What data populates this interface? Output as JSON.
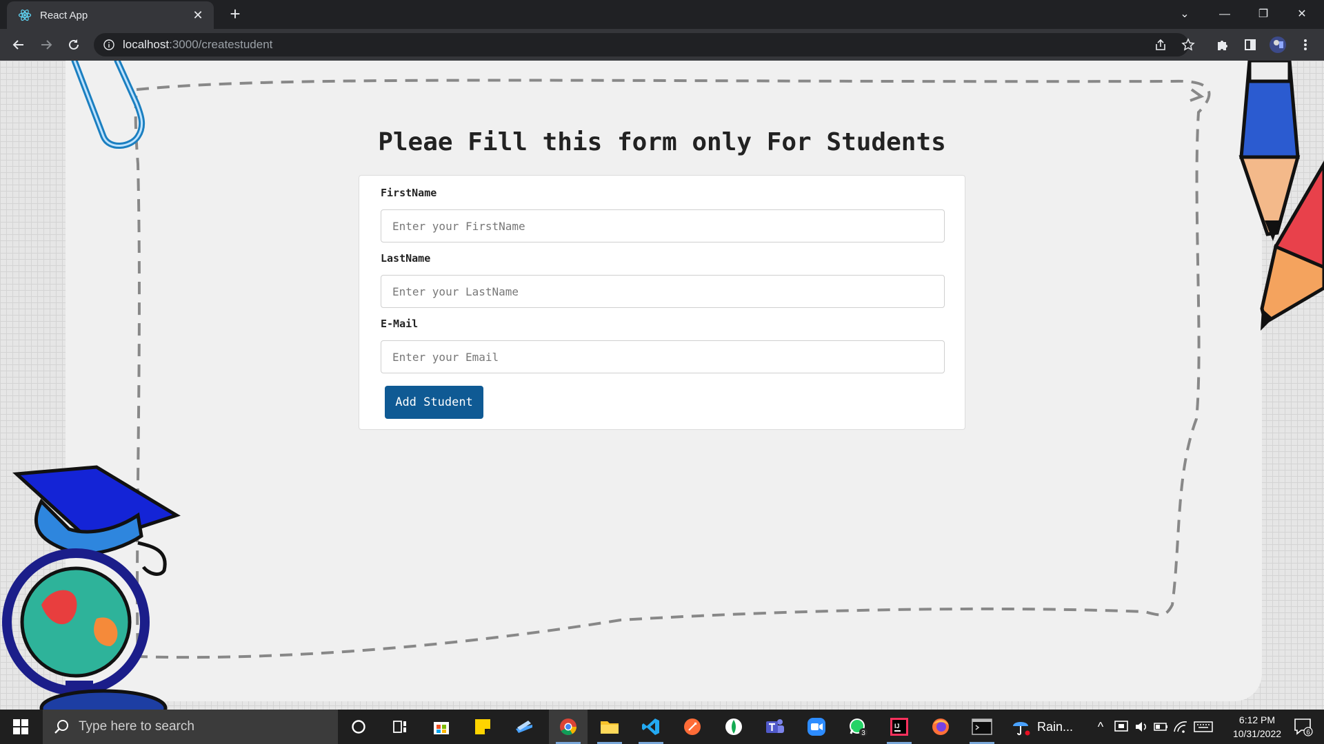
{
  "browser": {
    "tab_title": "React App",
    "url_host": "localhost",
    "url_path": ":3000/createstudent"
  },
  "page": {
    "title": "Pleae Fill this form only For Students"
  },
  "form": {
    "firstname_label": "FirstName",
    "firstname_placeholder": "Enter your FirstName",
    "lastname_label": "LastName",
    "lastname_placeholder": "Enter your LastName",
    "email_label": "E-Mail",
    "email_placeholder": "Enter your Email",
    "submit_label": "Add Student",
    "submit_color": "#0f5a94"
  },
  "taskbar": {
    "search_placeholder": "Type here to search",
    "weather_text": "Rain...",
    "time": "6:12 PM",
    "date": "10/31/2022",
    "whatsapp_badge": "3",
    "notification_count": "6",
    "apps": [
      "cortana-icon",
      "task-view-icon",
      "microsoft-store-icon",
      "sticky-notes-icon",
      "file-transfer-icon",
      "chrome-icon",
      "file-explorer-icon",
      "vscode-icon",
      "postman-icon",
      "mongodb-compass-icon",
      "teams-icon",
      "zoom-icon",
      "whatsapp-icon",
      "intellij-icon",
      "firefox-icon",
      "terminal-icon"
    ]
  }
}
